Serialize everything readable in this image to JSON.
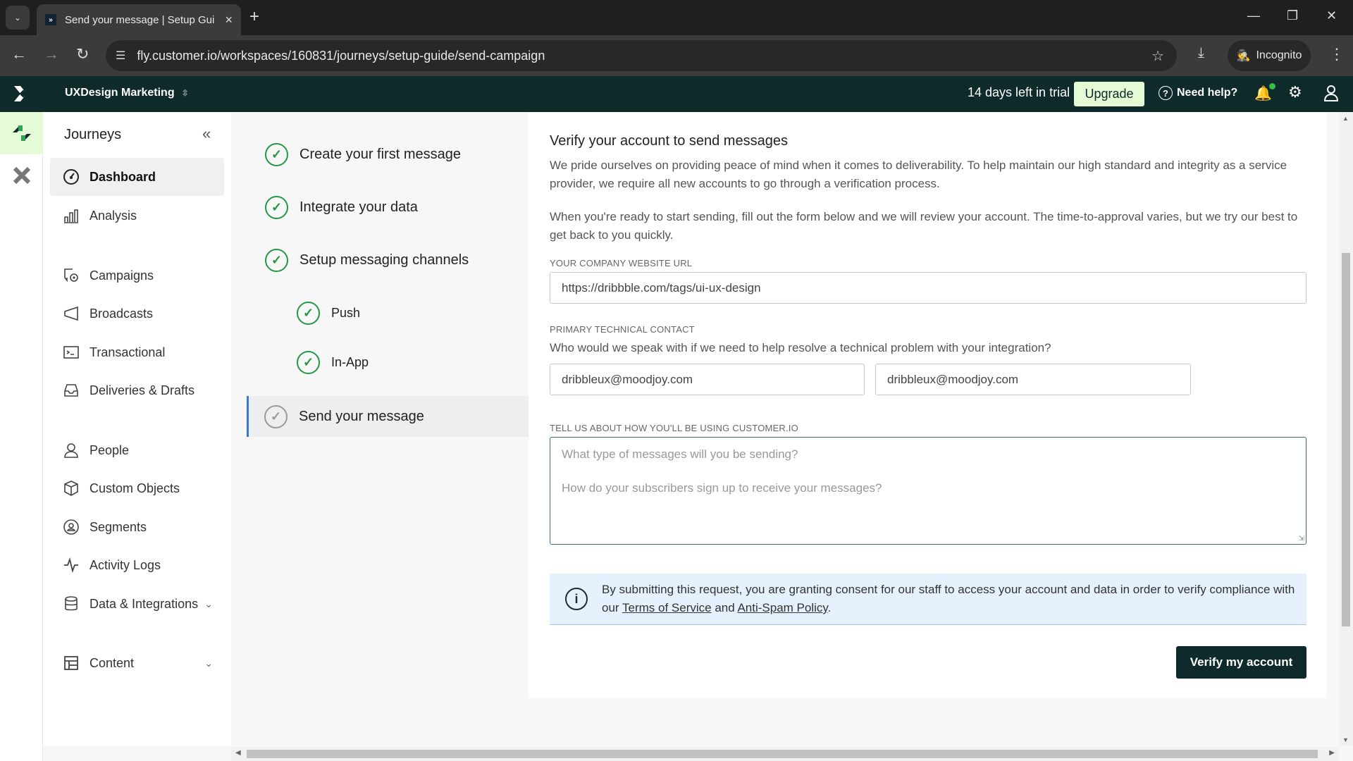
{
  "browser": {
    "tab_title": "Send your message | Setup Gui",
    "url": "fly.customer.io/workspaces/160831/journeys/setup-guide/send-campaign",
    "incognito_label": "Incognito"
  },
  "header": {
    "workspace": "UXDesign Marketing",
    "trial_text": "14 days left in trial",
    "upgrade_label": "Upgrade",
    "help_label": "Need help?"
  },
  "sidebar": {
    "title": "Journeys",
    "items": [
      {
        "label": "Dashboard",
        "icon": "dashboard-icon",
        "active": true
      },
      {
        "label": "Analysis",
        "icon": "bar-chart-icon"
      },
      {
        "label": "Campaigns",
        "icon": "campaigns-icon"
      },
      {
        "label": "Broadcasts",
        "icon": "megaphone-icon"
      },
      {
        "label": "Transactional",
        "icon": "terminal-icon"
      },
      {
        "label": "Deliveries & Drafts",
        "icon": "inbox-icon"
      },
      {
        "label": "People",
        "icon": "person-icon"
      },
      {
        "label": "Custom Objects",
        "icon": "cube-icon"
      },
      {
        "label": "Segments",
        "icon": "segments-icon"
      },
      {
        "label": "Activity Logs",
        "icon": "activity-icon"
      },
      {
        "label": "Data & Integrations",
        "icon": "database-icon",
        "expandable": true
      },
      {
        "label": "Content",
        "icon": "layout-icon",
        "expandable": true
      }
    ]
  },
  "steps": [
    {
      "label": "Create your first message",
      "done": true
    },
    {
      "label": "Integrate your data",
      "done": true
    },
    {
      "label": "Setup messaging channels",
      "done": true
    },
    {
      "label": "Push",
      "done": true,
      "sub": true
    },
    {
      "label": "In-App",
      "done": true,
      "sub": true
    },
    {
      "label": "Send your message",
      "done": false,
      "current": true
    }
  ],
  "form": {
    "title": "Verify your account to send messages",
    "intro1": "We pride ourselves on providing peace of mind when it comes to deliverability. To help maintain our high standard and integrity as a service provider, we require all new accounts to go through a verification process.",
    "intro2": "When you're ready to start sending, fill out the form below and we will review your account. The time-to-approval varies, but we try our best to get back to you quickly.",
    "website_label": "YOUR COMPANY WEBSITE URL",
    "website_value": "https://dribbble.com/tags/ui-ux-design",
    "contact_label": "PRIMARY TECHNICAL CONTACT",
    "contact_question": "Who would we speak with if we need to help resolve a technical problem with your integration?",
    "contact_name_value": "dribbleux@moodjoy.com",
    "contact_email_value": "dribbleux@moodjoy.com",
    "usage_label": "TELL US ABOUT HOW YOU'LL BE USING CUSTOMER.IO",
    "usage_placeholder_1": "What type of messages will you be sending?",
    "usage_placeholder_2": "How do your subscribers sign up to receive your messages?",
    "notice_text_1": "By submitting this request, you are granting consent for our staff to access your account and data in order to verify compliance with our ",
    "terms_link": "Terms of Service",
    "notice_and": " and ",
    "antispam_link": "Anti-Spam Policy",
    "notice_end": ".",
    "submit_label": "Verify my account"
  },
  "colors": {
    "brand_dark": "#0e2a2a",
    "accent_green": "#239845",
    "upgrade_bg": "#e4fbd6",
    "notice_bg": "#e5f2fd"
  }
}
